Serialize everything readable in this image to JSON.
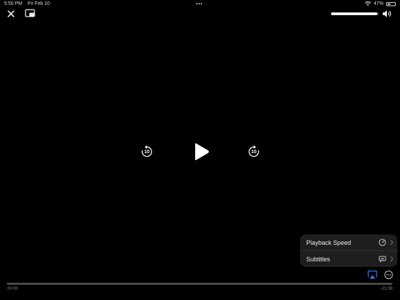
{
  "status_bar": {
    "time": "5:50 PM",
    "date": "Fri Feb 10",
    "more_dots": "•••",
    "battery_text": "47%",
    "battery_level": 0.47
  },
  "player": {
    "volume_level": 0.97,
    "skip_back_seconds": "10",
    "skip_forward_seconds": "10",
    "progress": 0.0,
    "elapsed": "00:00",
    "remaining": "−21:39"
  },
  "menu": {
    "items": [
      {
        "label": "Playback Speed",
        "icon": "speedometer-icon"
      },
      {
        "label": "Subtitles",
        "icon": "speech-bubble-icon"
      }
    ]
  },
  "colors": {
    "background": "#000000",
    "menu_background": "#1e1e1e",
    "airplay_accent": "#2f7cf6"
  }
}
